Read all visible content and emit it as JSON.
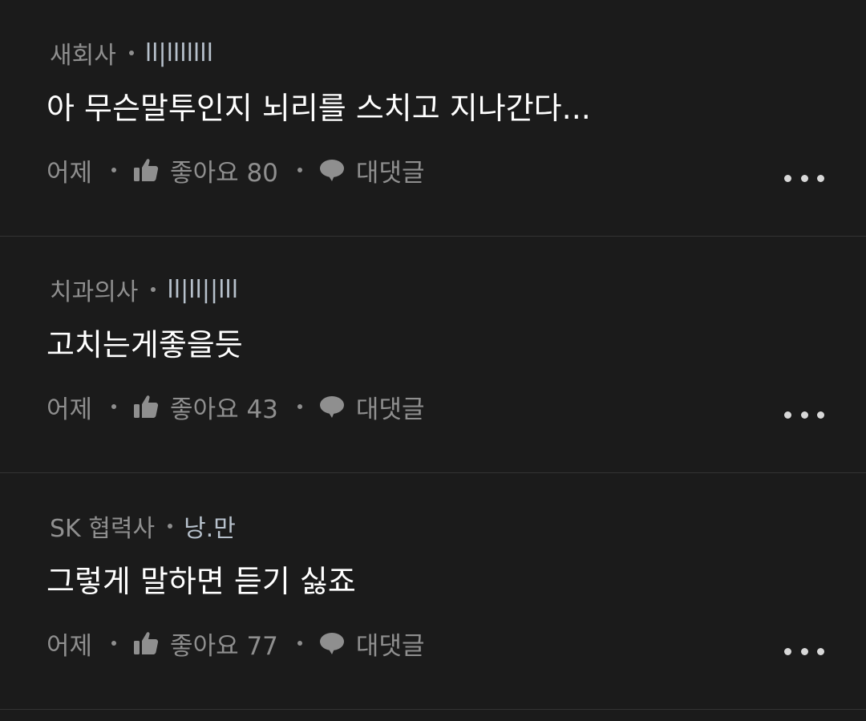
{
  "comments": [
    {
      "company": "새회사",
      "nickname": "ll|lllllll",
      "text": "아 무슨말투인지 뇌리를 스치고 지나간다...",
      "time": "어제",
      "like_label": "좋아요 80",
      "reply_label": "대댓글"
    },
    {
      "company": "치과의사",
      "nickname": "ll|ll||lll",
      "text": "고치는게좋을듯",
      "time": "어제",
      "like_label": "좋아요 43",
      "reply_label": "대댓글"
    },
    {
      "company": "SK 협력사",
      "nickname": "낭.만",
      "text": "그렇게 말하면 듣기 싫죠",
      "time": "어제",
      "like_label": "좋아요 77",
      "reply_label": "대댓글"
    }
  ],
  "icons": {
    "like": "thumbs-up-icon",
    "reply": "speech-bubble-icon",
    "more": "more-dots-icon"
  },
  "colors": {
    "background": "#1b1b1b",
    "meta_text": "#8f8f8f",
    "nickname": "#b7c1cc",
    "divider": "#343434"
  }
}
